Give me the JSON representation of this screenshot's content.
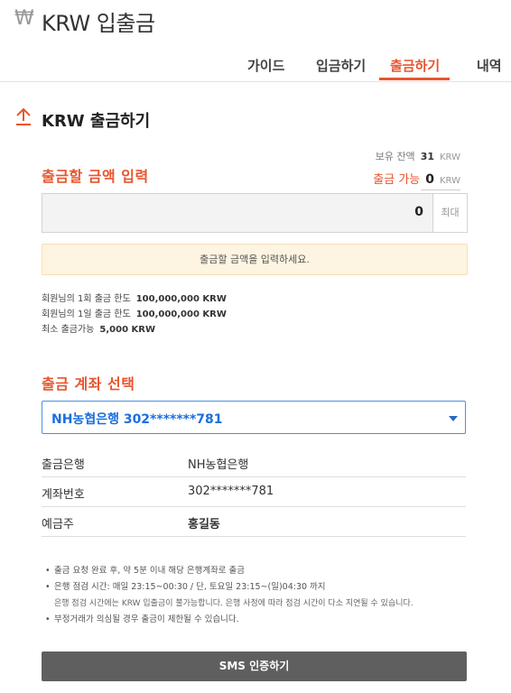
{
  "header": {
    "currency_symbol": "₩",
    "title": "KRW 입출금"
  },
  "tabs": [
    {
      "label": "가이드",
      "active": false
    },
    {
      "label": "입금하기",
      "active": false
    },
    {
      "label": "출금하기",
      "active": true
    },
    {
      "label": "내역",
      "active": false
    }
  ],
  "section": {
    "icon": "upload-arrow-icon",
    "title": "KRW 출금하기"
  },
  "balance": {
    "held_label": "보유 잔액",
    "held_value": "31",
    "held_unit": "KRW",
    "available_label": "출금 가능",
    "available_value": "0",
    "available_unit": "KRW"
  },
  "amount": {
    "heading": "출금할 금액 입력",
    "value": "0",
    "max_label": "최대",
    "notice": "출금할 금액을 입력하세요."
  },
  "limits": [
    {
      "label": "회원님의 1회 출금 한도",
      "value": "100,000,000 KRW"
    },
    {
      "label": "회원님의 1일 출금 한도",
      "value": "100,000,000 KRW"
    },
    {
      "label": "최소 출금가능",
      "value": "5,000 KRW"
    }
  ],
  "account": {
    "heading": "출금 계좌 선택",
    "selected": "NH농협은행 302*******781",
    "rows": [
      {
        "label": "출금은행",
        "value": "NH농협은행"
      },
      {
        "label": "계좌번호",
        "value": "302*******781"
      },
      {
        "label": "예금주",
        "value": "홍길동"
      }
    ]
  },
  "notes": {
    "n1": "출금 요청 완료 후, 약 5분 이내 해당 은행계좌로 출금",
    "n2": "은행 점검 시간: 매일 23:15~00:30 / 단, 토요일 23:15~(일)04:30 까지",
    "n2_sub": "은행 점검 시간에는 KRW 입출금이 불가능합니다. 은행 사정에 따라 점검 시간이 다소 지연될 수 있습니다.",
    "n3": "부정거래가 의심될 경우 출금이 제한될 수 있습니다."
  },
  "sms_button": "SMS 인증하기",
  "colors": {
    "accent": "#e8552f",
    "select_border": "#4a90e2",
    "button_bg": "#5f5f5f"
  }
}
